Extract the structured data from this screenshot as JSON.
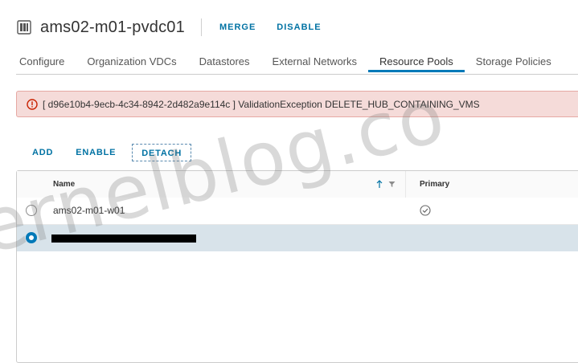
{
  "header": {
    "title": "ams02-m01-pvdc01",
    "merge_label": "MERGE",
    "disable_label": "DISABLE"
  },
  "tabs": [
    {
      "label": "Configure"
    },
    {
      "label": "Organization VDCs"
    },
    {
      "label": "Datastores"
    },
    {
      "label": "External Networks"
    },
    {
      "label": "Resource Pools",
      "active": true
    },
    {
      "label": "Storage Policies"
    }
  ],
  "alert": {
    "message": "[ d96e10b4-9ecb-4c34-8942-2d482a9e114c ] ValidationException DELETE_HUB_CONTAINING_VMS"
  },
  "actions": {
    "add_label": "ADD",
    "enable_label": "ENABLE",
    "detach_label": "DETACH"
  },
  "grid": {
    "col_name": "Name",
    "col_primary": "Primary",
    "rows": [
      {
        "name": "ams02-m01-w01",
        "primary": true,
        "selected": false
      },
      {
        "name": "",
        "primary": false,
        "selected": true,
        "redacted": true
      }
    ]
  },
  "watermark": "ernelblog.co",
  "colors": {
    "accent": "#0072a3",
    "tab_active": "#0079b8",
    "alert_bg": "#f5dbd9",
    "alert_icon": "#c92100",
    "selected_row": "#d8e3ea"
  }
}
